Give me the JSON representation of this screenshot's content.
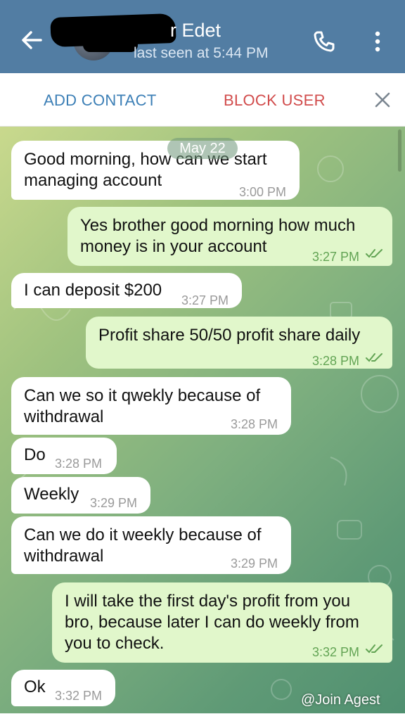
{
  "header": {
    "title": "r Edet",
    "subtitle": "last seen at 5:44 PM"
  },
  "actions": {
    "add_contact": "ADD CONTACT",
    "block_user": "BLOCK USER"
  },
  "date_chip": "May 22",
  "messages": [
    {
      "dir": "in",
      "text": "Good morning, how can we start\nmanaging account",
      "time": "3:00 PM"
    },
    {
      "dir": "out",
      "text": "Yes brother good morning how much\nmoney is in your account",
      "time": "3:27 PM"
    },
    {
      "dir": "in",
      "text": "I can deposit $200",
      "time": "3:27 PM"
    },
    {
      "dir": "out",
      "text": "Profit share 50/50 profit share daily",
      "time": "3:28 PM"
    },
    {
      "dir": "in",
      "text": "Can we so it qwekly because of\nwithdrawal",
      "time": "3:28 PM"
    },
    {
      "dir": "in",
      "text": "Do",
      "time": "3:28 PM"
    },
    {
      "dir": "in",
      "text": "Weekly",
      "time": "3:29 PM"
    },
    {
      "dir": "in",
      "text": "Can we do it weekly because of\nwithdrawal",
      "time": "3:29 PM"
    },
    {
      "dir": "out",
      "text": "I will take the first day's profit from you\nbro, because later I can do weekly from\nyou to check.",
      "time": "3:32 PM"
    },
    {
      "dir": "in",
      "text": "Ok",
      "time": "3:32 PM"
    }
  ],
  "watermark": "@Join Agest",
  "colors": {
    "header": "#527da3",
    "incoming": "#ffffff",
    "outgoing": "#e1f7cb",
    "add_contact": "#3c7fb6",
    "block_user": "#d14b4b"
  },
  "icons": [
    "back-arrow-icon",
    "phone-icon",
    "more-vertical-icon",
    "close-icon",
    "double-check-icon"
  ]
}
